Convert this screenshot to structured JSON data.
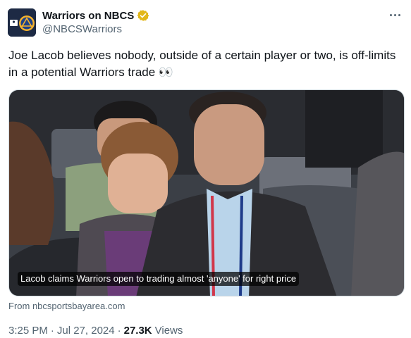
{
  "author": {
    "display_name": "Warriors on NBCS",
    "handle": "@NBCSWarriors",
    "avatar_icon": "warriors-bridge-logo-icon",
    "verified_icon": "gold-verified-badge-icon",
    "verified_color": "#e2b719"
  },
  "tweet": {
    "text": "Joe Lacob believes nobody, outside of a certain player or two, is off-limits in a potential Warriors trade 👀"
  },
  "link_card": {
    "image_caption": "Lacob claims Warriors open to trading almost 'anyone' for right price",
    "source": "From nbcsportsbayarea.com"
  },
  "meta": {
    "time": "3:25 PM",
    "separator1": "·",
    "date": "Jul 27, 2024",
    "separator2": "·",
    "views_count": "27.3K",
    "views_label": "Views"
  },
  "more_icon": "more-horizontal-icon"
}
